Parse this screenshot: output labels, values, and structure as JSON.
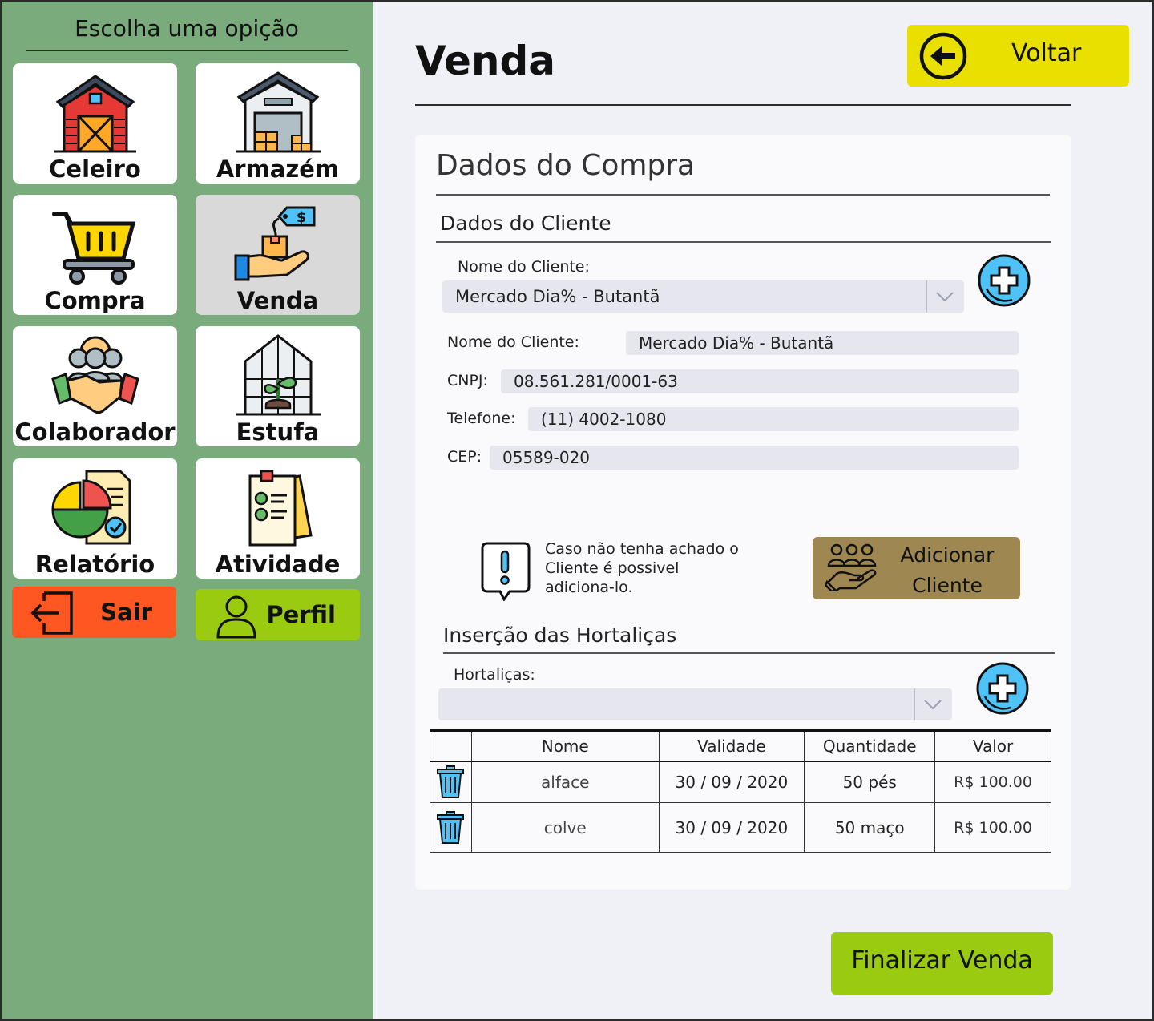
{
  "sidebar": {
    "title": "Escolha uma opição",
    "tiles": [
      {
        "label": "Celeiro",
        "icon": "barn-icon"
      },
      {
        "label": "Armazém",
        "icon": "warehouse-icon"
      },
      {
        "label": "Compra",
        "icon": "cart-icon"
      },
      {
        "label": "Venda",
        "icon": "sale-icon",
        "active": true
      },
      {
        "label": "Colaborador",
        "icon": "handshake-team-icon"
      },
      {
        "label": "Estufa",
        "icon": "greenhouse-icon"
      },
      {
        "label": "Relatório",
        "icon": "report-icon"
      },
      {
        "label": "Atividade",
        "icon": "checklist-icon"
      }
    ],
    "sair_label": "Sair",
    "perfil_label": "Perfil"
  },
  "header": {
    "title": "Venda",
    "voltar_label": "Voltar"
  },
  "card": {
    "title": "Dados do Compra",
    "cliente": {
      "section_title": "Dados do Cliente",
      "select_label": "Nome do Cliente:",
      "select_value": "Mercado Dia% - Butantã",
      "nome_label": "Nome do Cliente:",
      "nome_value": "Mercado Dia% - Butantã",
      "cnpj_label": "CNPJ:",
      "cnpj_value": "08.561.281/0001-63",
      "telefone_label": "Telefone:",
      "telefone_value": "(11) 4002-1080",
      "cep_label": "CEP:",
      "cep_value": "05589-020"
    },
    "notice": {
      "line1": "Caso não tenha achado o",
      "line2": "Cliente é possivel",
      "line3": "adiciona-lo."
    },
    "add_cliente": {
      "line1": "Adicionar",
      "line2": "Cliente"
    },
    "hortalicas": {
      "section_title": "Inserção das Hortaliças",
      "select_label": "Hortaliças:",
      "select_value": "",
      "columns": [
        "",
        "Nome",
        "Validade",
        "Quantidade",
        "Valor"
      ],
      "rows": [
        {
          "nome": "alface",
          "validade": "30 / 09 / 2020",
          "quantidade": "50 pés",
          "valor": "R$ 100.00"
        },
        {
          "nome": "colve",
          "validade": "30 / 09 / 2020",
          "quantidade": "50 maço",
          "valor": "R$ 100.00"
        }
      ]
    }
  },
  "finalizar_label": "Finalizar Venda",
  "colors": {
    "sidebar": "#79ab7c",
    "voltar": "#eae000",
    "sair": "#fe5722",
    "perfil": "#9acb10",
    "finalizar": "#9acb10",
    "adicionar": "#9e8751",
    "plus_circle": "#4fc3f7"
  }
}
